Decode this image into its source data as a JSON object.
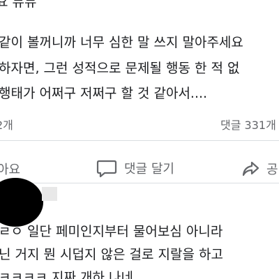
{
  "post": {
    "header_fragment": "요 뮤뮤",
    "body_lines": [
      "같이 볼꺼니까 너무 심한 말 쓰지 말아주세요",
      "하자면, 그런 성적으로 문제될 행동 한 적 없",
      " 행태가 어쩌구 저쩌구 할 것 같아서...."
    ]
  },
  "stats": {
    "left_fragment": "2개",
    "comments_count": "댓글 331개"
  },
  "actions": {
    "like_fragment": "아요",
    "comment_label": "댓글 달기",
    "share_fragment": "공"
  },
  "comment": {
    "lines": [
      "ㄹㅇ 일단 페미인지부터 물어보심 아니라",
      "닌 거지 뭔 시덥지 않은 걸로 지랄을 하고",
      "ㅋㅋㅋㅋ 지짜 개하 나네"
    ]
  },
  "colors": {
    "text": "#1c1e21",
    "muted": "#65676b",
    "divider": "#dadde1",
    "comment_bubble": "#f0f2f5"
  }
}
